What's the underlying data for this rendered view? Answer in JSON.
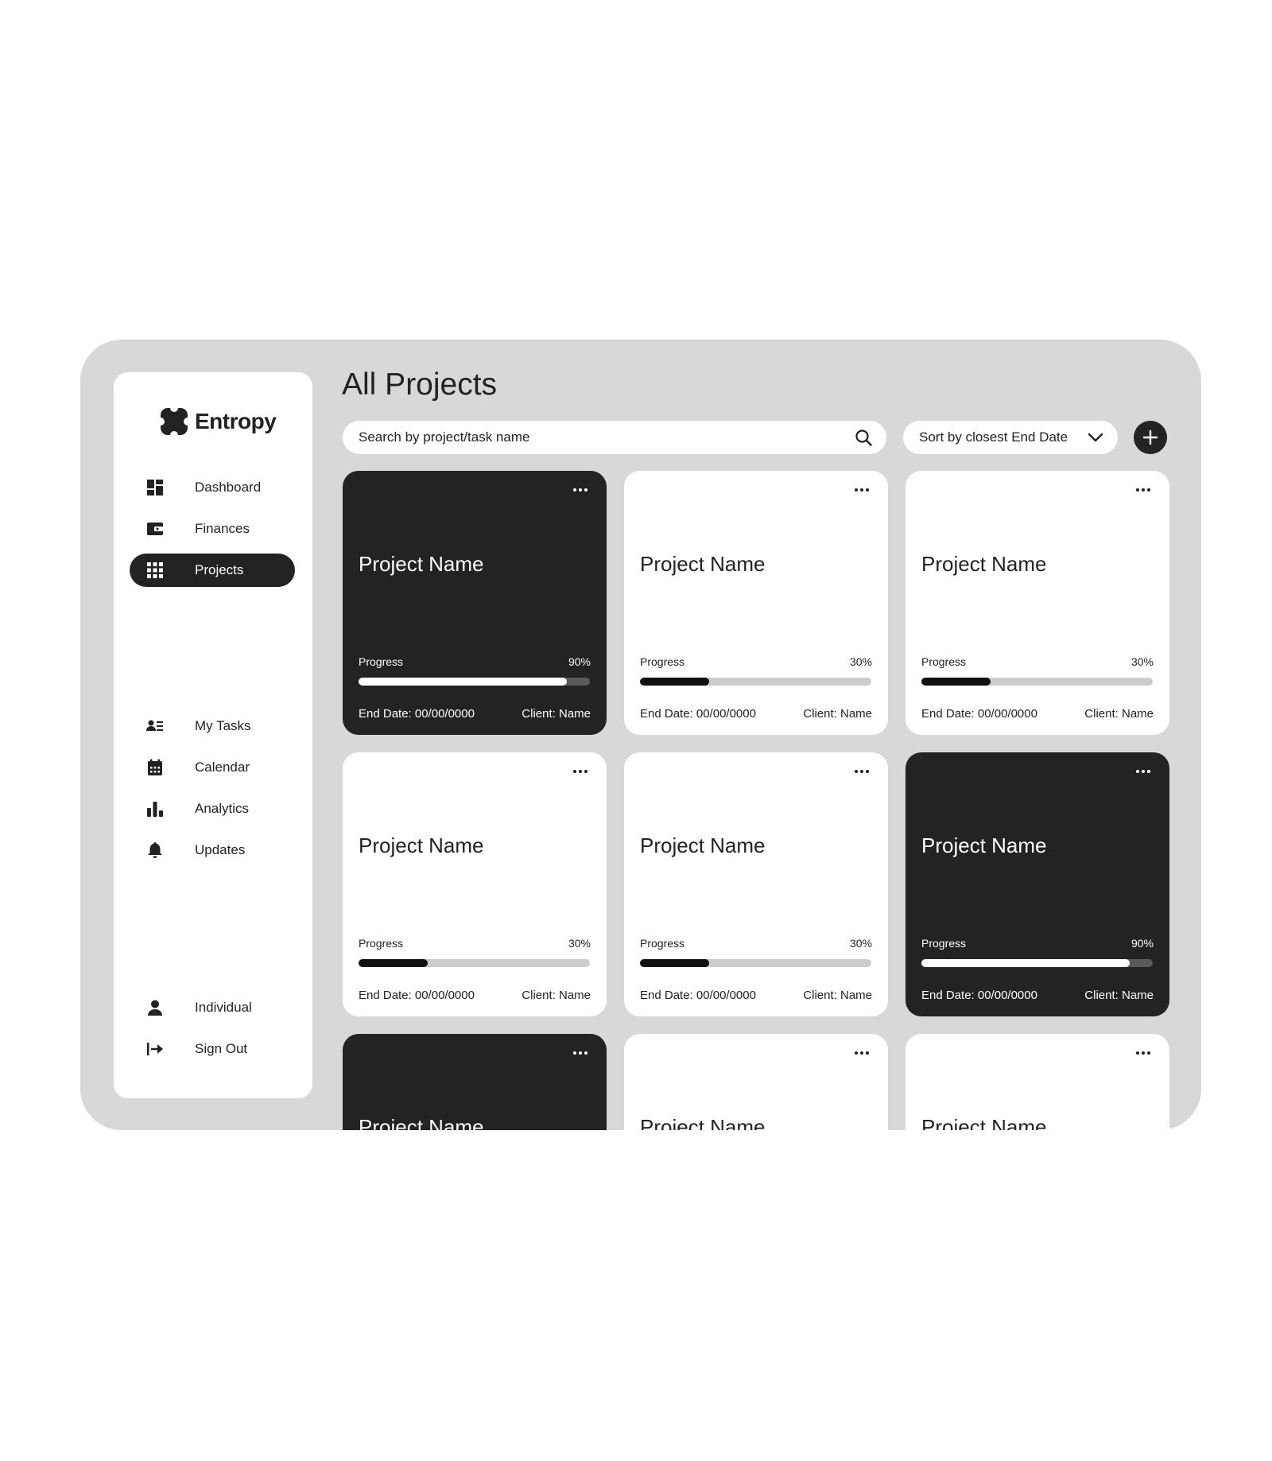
{
  "app": {
    "name": "Entropy"
  },
  "sidebar": {
    "items": [
      {
        "label": "Dashboard",
        "icon": "dashboard-icon"
      },
      {
        "label": "Finances",
        "icon": "wallet-icon"
      },
      {
        "label": "Projects",
        "icon": "grid-icon",
        "active": true
      },
      {
        "label": "My Tasks",
        "icon": "tasks-icon"
      },
      {
        "label": "Calendar",
        "icon": "calendar-icon"
      },
      {
        "label": "Analytics",
        "icon": "bar-chart-icon"
      },
      {
        "label": "Updates",
        "icon": "bell-icon"
      },
      {
        "label": "Individual",
        "icon": "user-icon"
      },
      {
        "label": "Sign Out",
        "icon": "sign-out-icon"
      }
    ]
  },
  "main": {
    "title": "All Projects",
    "search": {
      "placeholder": "Search by project/task name"
    },
    "sort": {
      "label": "Sort by closest End Date"
    }
  },
  "colors": {
    "dark": "#232323",
    "frame": "#d8d8d8",
    "track": "#cccccc"
  },
  "projects": [
    {
      "name": "Project Name",
      "progress_label": "Progress",
      "progress_text": "90%",
      "progress": 0.9,
      "end_date": "End Date: 00/00/0000",
      "client": "Client: Name",
      "dark": true
    },
    {
      "name": "Project Name",
      "progress_label": "Progress",
      "progress_text": "30%",
      "progress": 0.3,
      "end_date": "End Date: 00/00/0000",
      "client": "Client: Name",
      "dark": false
    },
    {
      "name": "Project Name",
      "progress_label": "Progress",
      "progress_text": "30%",
      "progress": 0.3,
      "end_date": "End Date: 00/00/0000",
      "client": "Client: Name",
      "dark": false
    },
    {
      "name": "Project Name",
      "progress_label": "Progress",
      "progress_text": "30%",
      "progress": 0.3,
      "end_date": "End Date: 00/00/0000",
      "client": "Client: Name",
      "dark": false
    },
    {
      "name": "Project Name",
      "progress_label": "Progress",
      "progress_text": "30%",
      "progress": 0.3,
      "end_date": "End Date: 00/00/0000",
      "client": "Client: Name",
      "dark": false
    },
    {
      "name": "Project Name",
      "progress_label": "Progress",
      "progress_text": "90%",
      "progress": 0.9,
      "end_date": "End Date: 00/00/0000",
      "client": "Client: Name",
      "dark": true
    },
    {
      "name": "Project Name",
      "dark": true
    },
    {
      "name": "Project Name",
      "dark": false
    },
    {
      "name": "Project Name",
      "dark": false
    }
  ]
}
